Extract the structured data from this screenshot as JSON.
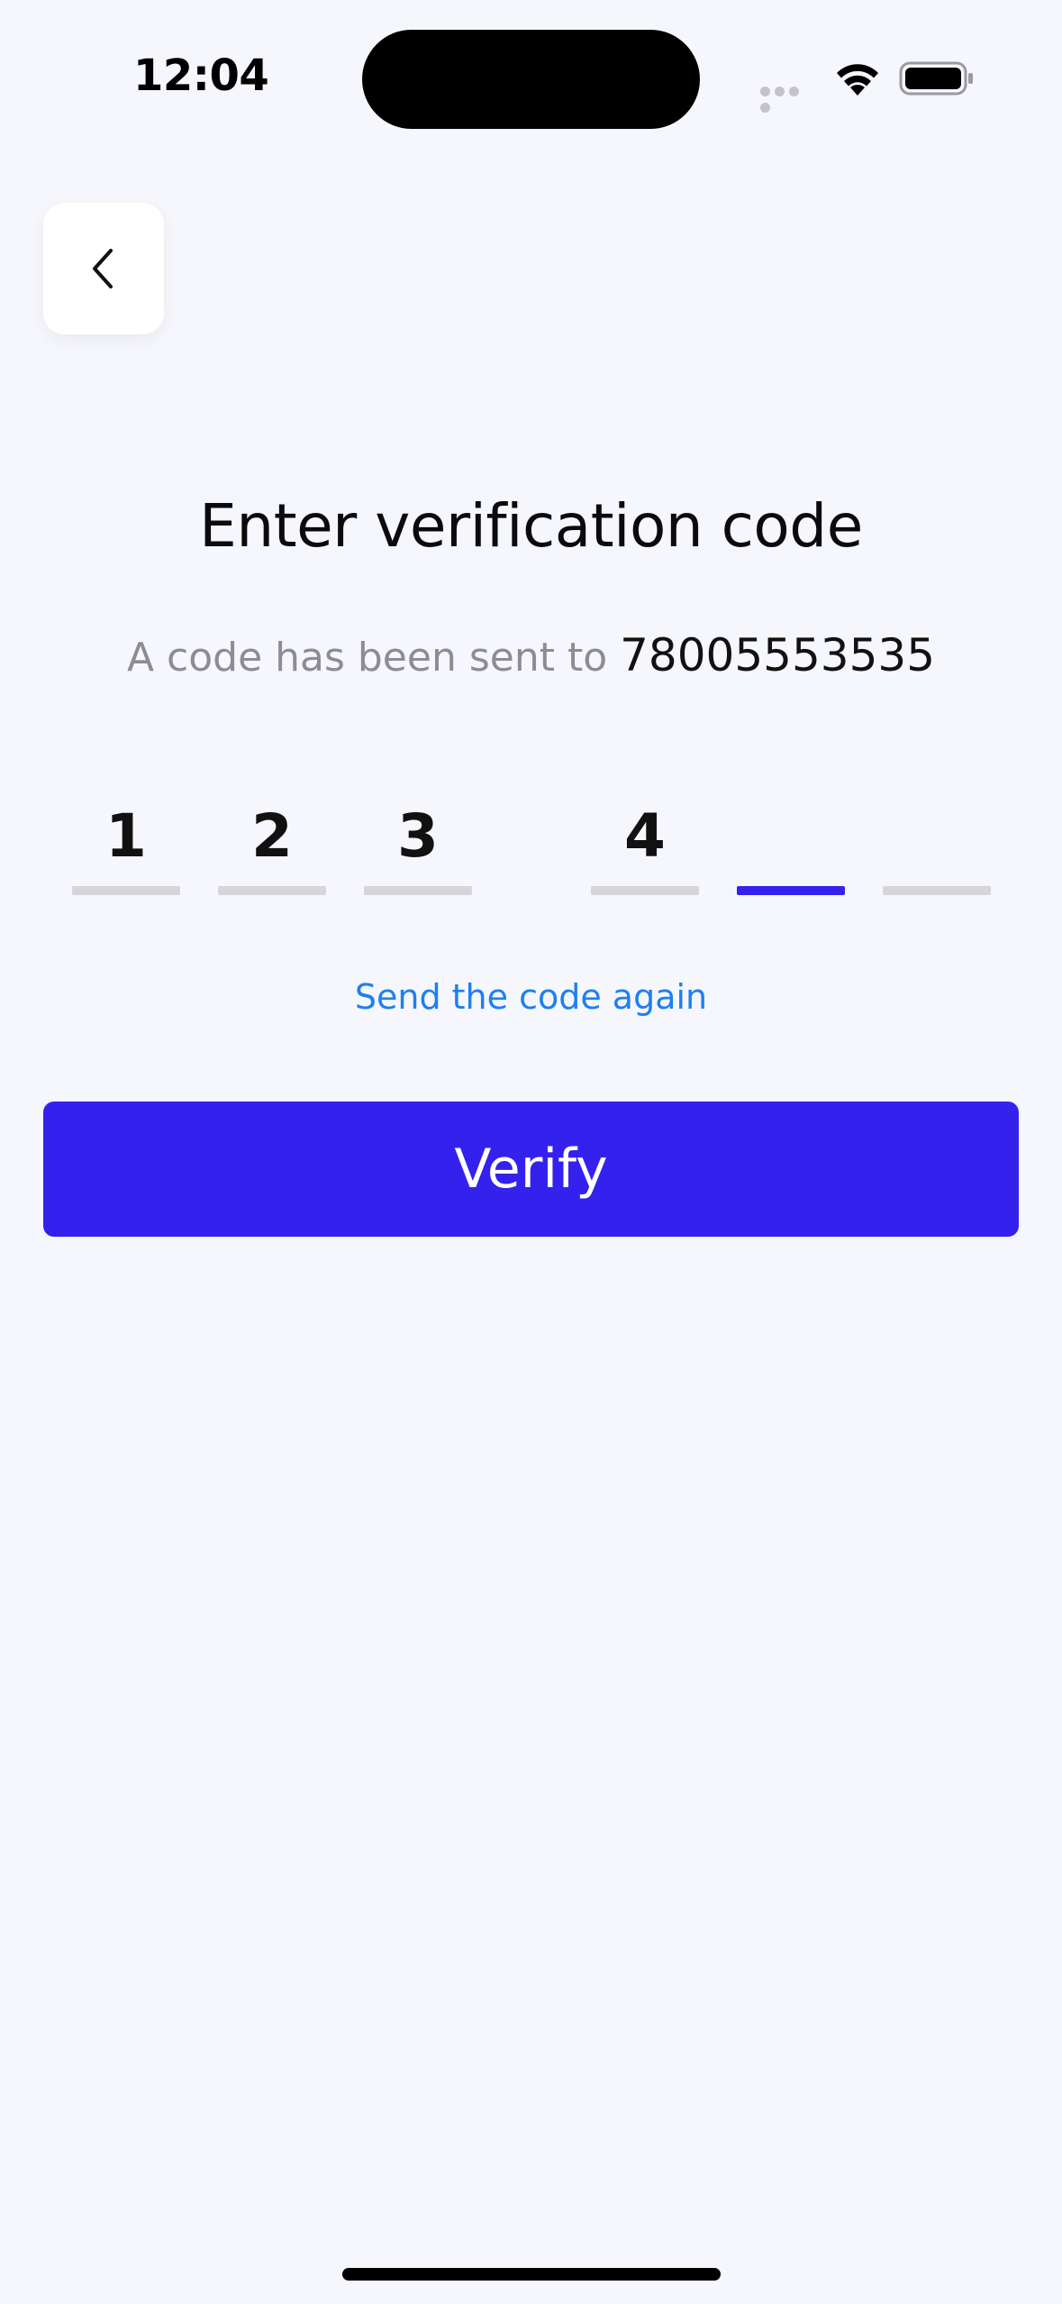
{
  "status_bar": {
    "time": "12:04"
  },
  "back_button": {
    "icon": "chevron-left-icon"
  },
  "title": "Enter verification code",
  "subtitle": {
    "prefix": "A code has been sent to",
    "phone": "78005553535"
  },
  "code": {
    "digits": [
      "1",
      "2",
      "3",
      "4",
      "",
      ""
    ],
    "active_index": 4
  },
  "resend_label": "Send the code again",
  "verify_label": "Verify",
  "colors": {
    "accent": "#3521ee",
    "link": "#1f7ff0",
    "background": "#f6f7fc",
    "inactive_underline": "#d5d5da"
  }
}
